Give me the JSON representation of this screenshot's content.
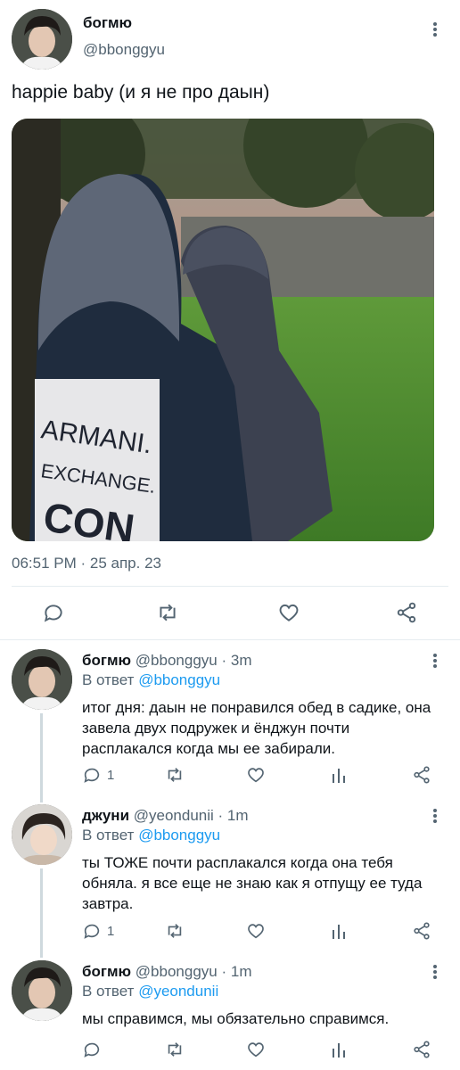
{
  "main_tweet": {
    "author_name": "богмю",
    "author_handle": "@bbonggyu",
    "text": "happie baby (и я не про даын)",
    "photo_text_lines": [
      "ARMANI.",
      "EXCHANGE.",
      "CON"
    ],
    "timestamp": "06:51 PM · 25 апр. 23"
  },
  "replies": [
    {
      "author_name": "богмю",
      "author_handle": "@bbonggyu",
      "time": "· 3m",
      "reply_prefix": "В ответ",
      "reply_to": "@bbonggyu",
      "text": "итог дня: даын не понравился обед в садике, она завела двух подружек и ёнджун почти расплакался когда мы ее забирали.",
      "reply_count": "1"
    },
    {
      "author_name": "джуни",
      "author_handle": "@yeondunii",
      "time": "· 1m",
      "reply_prefix": "В ответ",
      "reply_to": "@bbonggyu",
      "text": "ты ТОЖЕ почти расплакался когда она тебя обняла. я все еще не знаю как я отпущу ее туда завтра.",
      "reply_count": "1"
    },
    {
      "author_name": "богмю",
      "author_handle": "@bbonggyu",
      "time": "· 1m",
      "reply_prefix": "В ответ",
      "reply_to": "@yeondunii",
      "text": "мы справимся, мы обязательно справимся.",
      "reply_count": ""
    }
  ],
  "icons": {
    "reply": "reply-icon",
    "retweet": "retweet-icon",
    "like": "like-icon",
    "share": "share-icon",
    "stats": "stats-icon",
    "more": "more-vertical-icon"
  },
  "colors": {
    "link": "#1d9bf0",
    "muted": "#536471",
    "text": "#0f1419"
  }
}
